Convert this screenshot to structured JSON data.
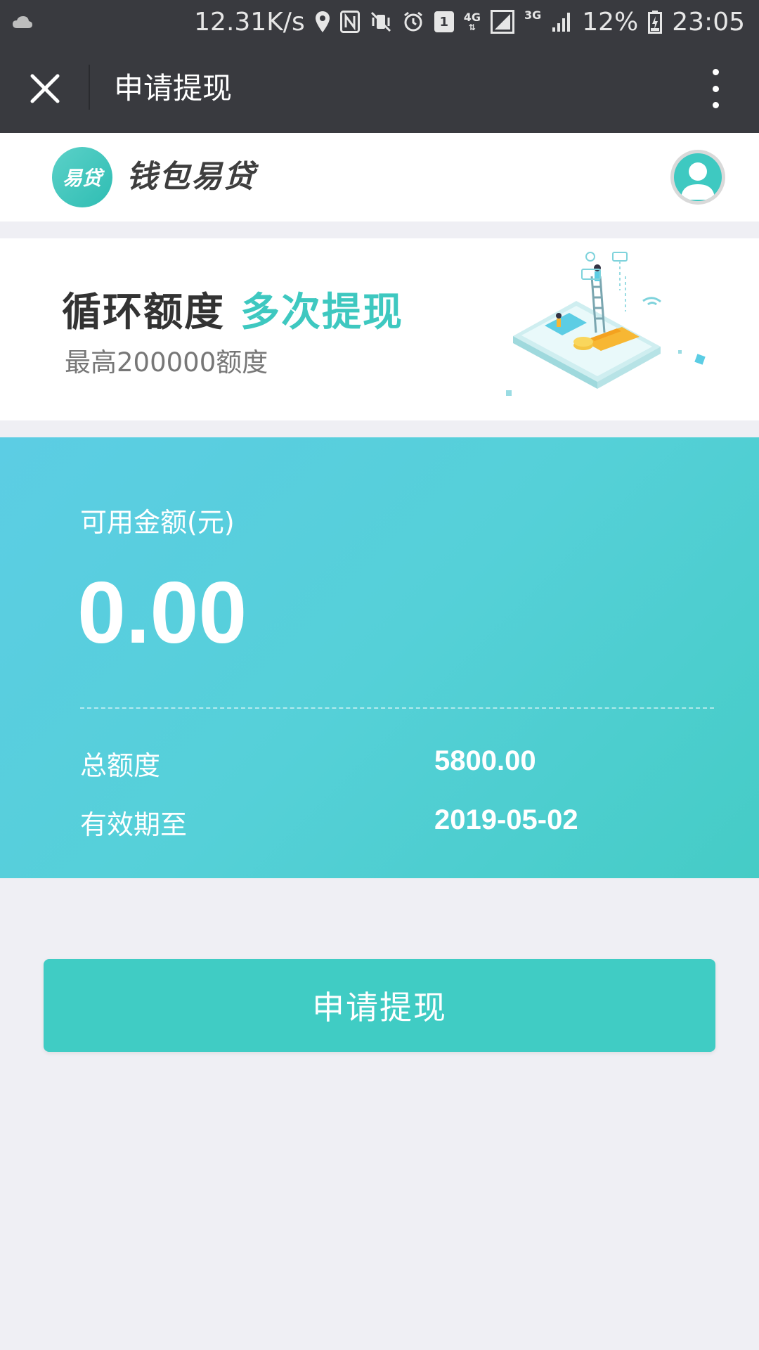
{
  "status_bar": {
    "network_speed": "12.31K/s",
    "sim_badge": "1",
    "net_4g": "4G",
    "net_3g": "3G",
    "battery": "12%",
    "time": "23:05"
  },
  "nav": {
    "title": "申请提现"
  },
  "brand": {
    "logo_text": "易贷",
    "name": "钱包易贷"
  },
  "banner": {
    "title_main": "循环额度",
    "title_accent": "多次提现",
    "subtitle": "最高200000额度"
  },
  "balance": {
    "available_label": "可用金额(元)",
    "available_amount": "0.00",
    "total_label": "总额度",
    "total_value": "5800.00",
    "expiry_label": "有效期至",
    "expiry_value": "2019-05-02"
  },
  "actions": {
    "withdraw_label": "申请提现"
  },
  "colors": {
    "accent": "#40ccc4",
    "nav_bg": "#393a3f",
    "page_bg": "#efeff4"
  }
}
